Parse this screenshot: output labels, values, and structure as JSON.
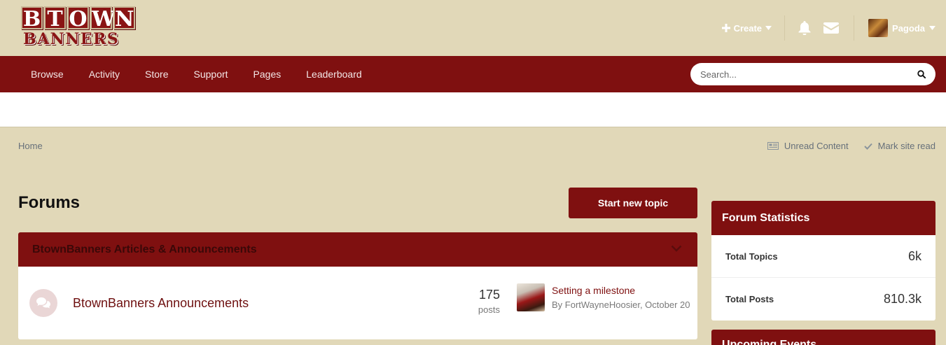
{
  "brand": {
    "letters_top": [
      "B",
      "T",
      "O",
      "W",
      "N"
    ],
    "bottom": "BANNERS"
  },
  "user_bar": {
    "create_label": "Create",
    "username": "Pagoda"
  },
  "nav": {
    "items": [
      "Browse",
      "Activity",
      "Store",
      "Support",
      "Pages",
      "Leaderboard"
    ]
  },
  "search": {
    "placeholder": "Search..."
  },
  "breadcrumb": {
    "home": "Home",
    "unread": "Unread Content",
    "mark_read": "Mark site read"
  },
  "page": {
    "title": "Forums",
    "start_topic": "Start new topic"
  },
  "category": {
    "title": "BtownBanners Articles & Announcements",
    "forum": {
      "name": "BtownBanners Announcements",
      "post_count": "175",
      "post_label": "posts",
      "last_post_title": "Setting a milestone",
      "last_post_meta": "By FortWayneHoosier, October 20"
    }
  },
  "stats": {
    "title": "Forum Statistics",
    "rows": [
      {
        "label": "Total Topics",
        "value": "6k"
      },
      {
        "label": "Total Posts",
        "value": "810.3k"
      }
    ]
  },
  "events": {
    "title": "Upcoming Events"
  },
  "colors": {
    "background": "#e1d8b8",
    "brand_red": "#7f1010",
    "link_red": "#6e1010"
  }
}
